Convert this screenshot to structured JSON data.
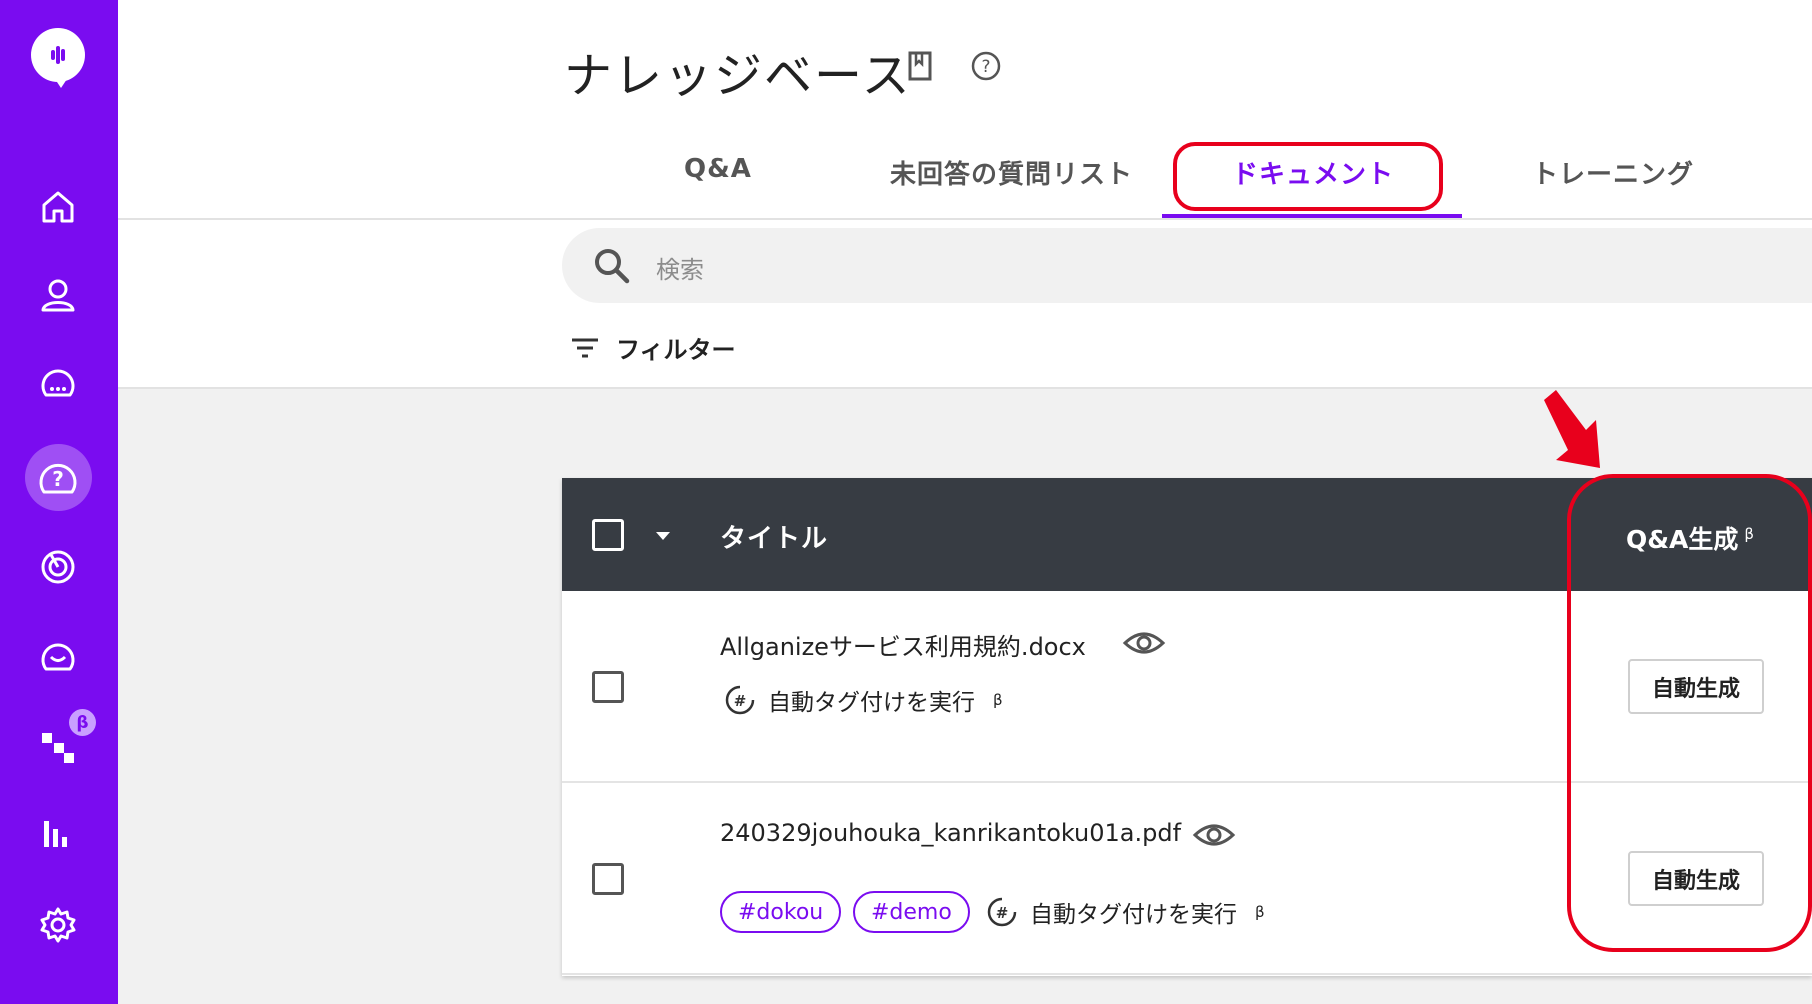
{
  "sidebar": {
    "logo": "allganize-logo",
    "items": [
      {
        "icon": "home-icon"
      },
      {
        "icon": "user-icon"
      },
      {
        "icon": "chat-icon"
      },
      {
        "icon": "help-icon",
        "active": true
      },
      {
        "icon": "target-icon"
      },
      {
        "icon": "smile-chat-icon"
      },
      {
        "icon": "flow-icon",
        "badge": "β"
      },
      {
        "icon": "chart-icon"
      },
      {
        "icon": "gear-icon"
      }
    ]
  },
  "header": {
    "title": "ナレッジベース",
    "icons": [
      "book-icon",
      "help-circle-icon"
    ]
  },
  "tabs": [
    {
      "label": "Q&A"
    },
    {
      "label": "未回答の質問リスト"
    },
    {
      "label": "ドキュメント",
      "active": true
    },
    {
      "label": "トレーニング"
    }
  ],
  "search": {
    "placeholder": "検索"
  },
  "filter": {
    "label": "フィルター"
  },
  "table": {
    "header": {
      "title": "タイトル",
      "qa": "Q&A生成",
      "qa_sup": "β"
    },
    "rows": [
      {
        "name": "Allganizeサービス利用規約.docx",
        "tags": [],
        "autotag": "自動タグ付けを実行",
        "autotag_sup": "β",
        "button": "自動生成"
      },
      {
        "name": "240329jouhouka_kanrikantoku01a.pdf",
        "tags": [
          "#dokou",
          "#demo"
        ],
        "autotag": "自動タグ付けを実行",
        "autotag_sup": "β",
        "button": "自動生成"
      }
    ]
  },
  "colors": {
    "accent": "#7a0cf0",
    "header_bg": "#373c43",
    "callout": "#e8001c"
  }
}
